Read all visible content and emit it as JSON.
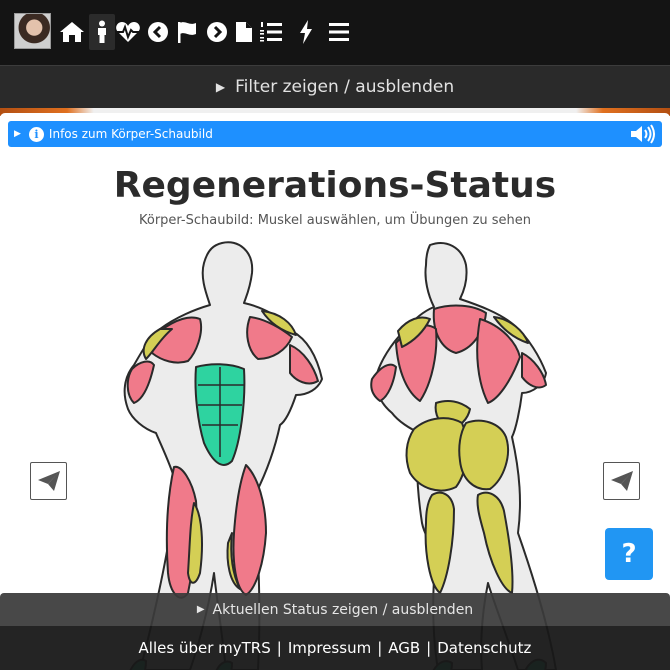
{
  "nav": {
    "items": [
      {
        "icon": "home-icon"
      },
      {
        "icon": "person-icon",
        "active": true
      },
      {
        "icon": "heartbeat-icon"
      },
      {
        "icon": "chevron-left-circle-icon"
      },
      {
        "icon": "flag-icon"
      },
      {
        "icon": "chevron-right-circle-icon"
      },
      {
        "icon": "document-icon"
      },
      {
        "icon": "numbered-list-icon"
      },
      {
        "icon": "bolt-icon"
      },
      {
        "icon": "hamburger-menu-icon"
      }
    ]
  },
  "filter": {
    "label": "Filter zeigen / ausblenden"
  },
  "info": {
    "label": "Infos zum Körper-Schaubild",
    "icon": "info-icon",
    "speaker_icon": "speaker-icon"
  },
  "main": {
    "title": "Regenerations-Status",
    "subtitle": "Körper-Schaubild: Muskel auswählen, um Übungen zu sehen"
  },
  "share": {
    "icon": "paper-plane-icon"
  },
  "help": {
    "label": "?"
  },
  "status": {
    "label": "Aktuellen Status zeigen / ausblenden"
  },
  "footer": {
    "about": "Alles über myTRS",
    "sep": "|",
    "imprint": "Impressum",
    "terms": "AGB",
    "privacy": "Datenschutz"
  },
  "colors": {
    "recovered": "#2ed3a0",
    "partial": "#d4cf55",
    "fatigued": "#f07a8a",
    "info_bar": "#1e90ff"
  }
}
